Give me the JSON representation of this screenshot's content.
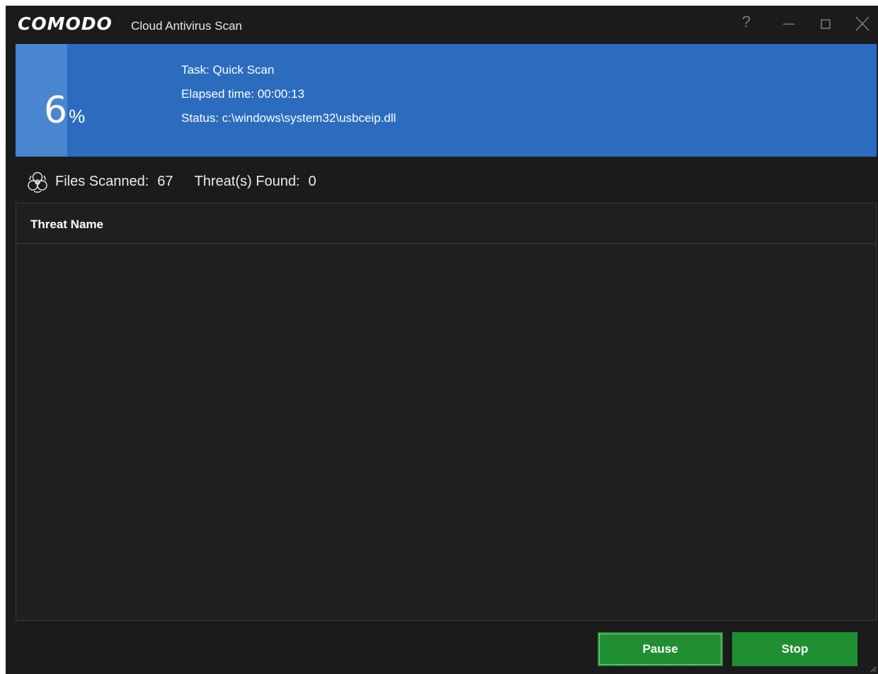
{
  "window": {
    "logo": "COMODO",
    "title": "Cloud Antivirus Scan",
    "controls": {
      "help": "?",
      "minimize": "minimize-icon",
      "maximize": "maximize-icon",
      "close": "close-icon"
    }
  },
  "scan": {
    "percent": "6",
    "percent_sign": "%",
    "progress_fraction": 0.06,
    "task": "Task: Quick Scan",
    "elapsed": "Elapsed time: 00:00:13",
    "status": "Status: c:\\windows\\system32\\usbceip.dll"
  },
  "stats": {
    "icon": "biohazard-icon",
    "files_scanned_label": "Files Scanned:",
    "files_scanned_value": "67",
    "threats_found_label": "Threat(s) Found:",
    "threats_found_value": "0"
  },
  "table": {
    "column_header": "Threat Name",
    "rows": []
  },
  "buttons": {
    "pause": "Pause",
    "stop": "Stop"
  },
  "colors": {
    "accent_blue": "#2b6cbf",
    "progress_fill": "#4a85cf",
    "button_green": "#1f8f31",
    "window_bg": "#1b1b1c"
  }
}
